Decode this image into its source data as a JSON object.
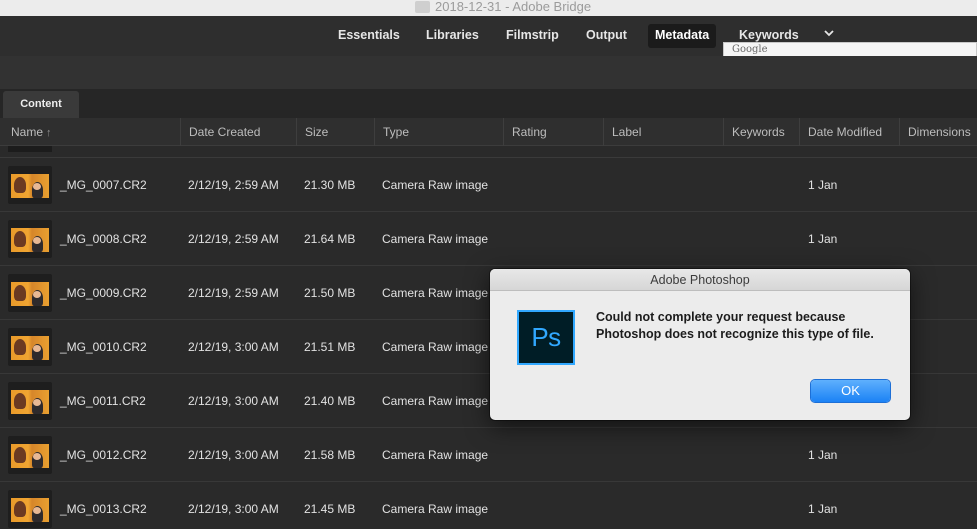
{
  "window": {
    "title": "2018-12-31 - Adobe Bridge"
  },
  "workspaces": [
    {
      "label": "Essentials",
      "active": false
    },
    {
      "label": "Libraries",
      "active": false
    },
    {
      "label": "Filmstrip",
      "active": false
    },
    {
      "label": "Output",
      "active": false
    },
    {
      "label": "Metadata",
      "active": true
    },
    {
      "label": "Keywords",
      "active": false
    }
  ],
  "workspace_more_icon": "chevron-down-icon",
  "google_popup": {
    "text": "Google"
  },
  "panel": {
    "tab": "Content"
  },
  "columns": {
    "name": "Name",
    "date_created": "Date Created",
    "size": "Size",
    "type": "Type",
    "rating": "Rating",
    "label": "Label",
    "keywords": "Keywords",
    "date_modified": "Date Modified",
    "dimensions": "Dimensions"
  },
  "sort_icon": "sort-ascending-arrow-icon",
  "files": [
    {
      "name": "_MG_0007.CR2",
      "date_created": "2/12/19, 2:59 AM",
      "size": "21.30 MB",
      "type": "Camera Raw image",
      "date_modified": "1 Jan"
    },
    {
      "name": "_MG_0008.CR2",
      "date_created": "2/12/19, 2:59 AM",
      "size": "21.64 MB",
      "type": "Camera Raw image",
      "date_modified": "1 Jan"
    },
    {
      "name": "_MG_0009.CR2",
      "date_created": "2/12/19, 2:59 AM",
      "size": "21.50 MB",
      "type": "Camera Raw image",
      "date_modified": ""
    },
    {
      "name": "_MG_0010.CR2",
      "date_created": "2/12/19, 3:00 AM",
      "size": "21.51 MB",
      "type": "Camera Raw image",
      "date_modified": ""
    },
    {
      "name": "_MG_0011.CR2",
      "date_created": "2/12/19, 3:00 AM",
      "size": "21.40 MB",
      "type": "Camera Raw image",
      "date_modified": ""
    },
    {
      "name": "_MG_0012.CR2",
      "date_created": "2/12/19, 3:00 AM",
      "size": "21.58 MB",
      "type": "Camera Raw image",
      "date_modified": "1 Jan"
    },
    {
      "name": "_MG_0013.CR2",
      "date_created": "2/12/19, 3:00 AM",
      "size": "21.45 MB",
      "type": "Camera Raw image",
      "date_modified": "1 Jan"
    }
  ],
  "dialog": {
    "title": "Adobe Photoshop",
    "logo_text": "Ps",
    "message": "Could not complete your request because Photoshop does not recognize this type of file.",
    "ok_label": "OK"
  },
  "colors": {
    "ps_logo_bg": "#001d26",
    "ps_logo_accent": "#31a8ff",
    "ok_button": "#1b82f5"
  }
}
